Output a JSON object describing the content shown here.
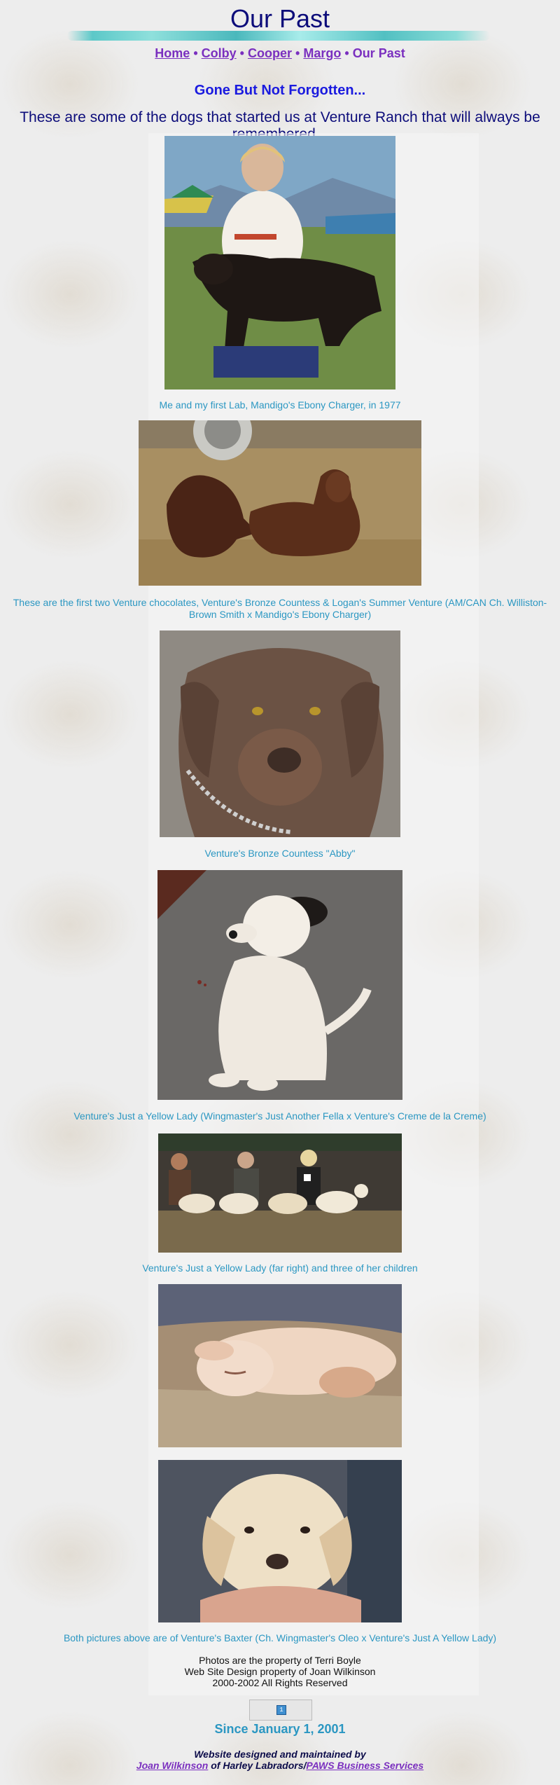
{
  "page": {
    "title": "Our Past",
    "nav": {
      "items": [
        {
          "label": "Home"
        },
        {
          "label": "Colby"
        },
        {
          "label": "Cooper"
        },
        {
          "label": "Margo"
        }
      ],
      "separator": "•",
      "current": "Our Past"
    },
    "heading": "Gone But Not Forgotten...",
    "intro": "These are some of the dogs that started us at Venture Ranch that will always be remembered..."
  },
  "photos": [
    {
      "caption": "Me and my first Lab, Mandigo's Ebony Charger, in 1977"
    },
    {
      "caption": "These are the first two Venture chocolates, Venture's Bronze Countess & Logan's Summer Venture (AM/CAN Ch. Williston-Brown Smith x Mandigo's Ebony Charger)"
    },
    {
      "caption": "Venture's Bronze Countess \"Abby\""
    },
    {
      "caption": "Venture's Just a Yellow Lady (Wingmaster's Just Another Fella x Venture's Creme de la Creme)"
    },
    {
      "caption": "Venture's Just a Yellow Lady (far right) and three of her children"
    },
    {
      "caption": "Both pictures above are of Venture's Baxter (Ch. Wingmaster's Oleo x Venture's Just A Yellow Lady)"
    }
  ],
  "credits": {
    "line1": "Photos are the property of Terri Boyle",
    "line2": "Web Site Design property of Joan Wilkinson",
    "line3": "2000-2002 All Rights Reserved"
  },
  "counter": {
    "digit": "1"
  },
  "since": "Since January 1, 2001",
  "footer": {
    "designed": "Website designed and maintained by",
    "name_link": "Joan Wilkinson",
    "of_text": "of Harley Labradors/",
    "business_link": "PAWS Business Services"
  },
  "colors": {
    "title": "#0c0c7a",
    "heading": "#1a1adf",
    "nav": "#7a2fbf",
    "caption": "#2b97c2"
  }
}
